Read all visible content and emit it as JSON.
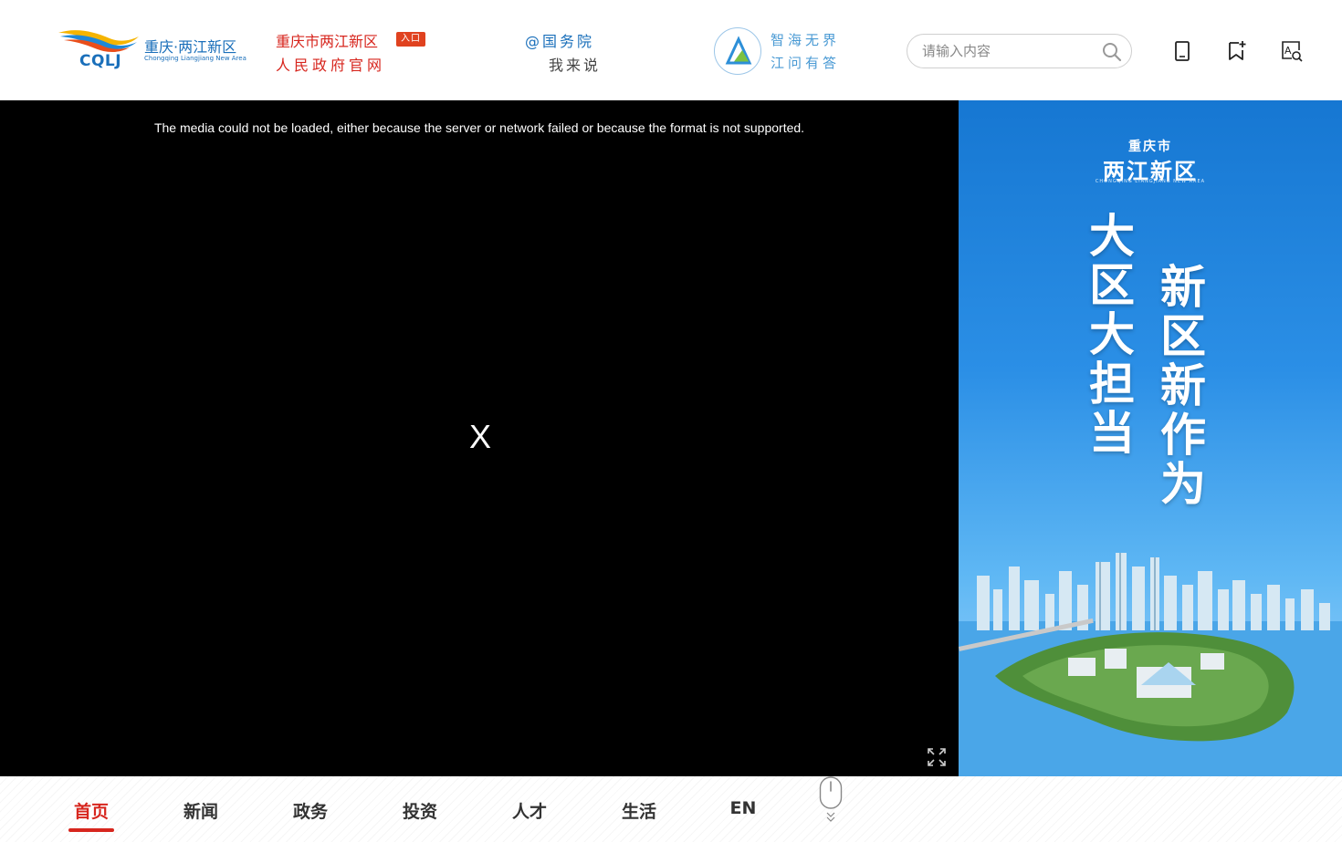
{
  "header": {
    "logo": {
      "abbr": "CQLJ",
      "name_cn": "重庆·两江新区",
      "name_en": "Chongqing Liangjiang New Area"
    },
    "gov_portal": {
      "line1": "重庆市两江新区",
      "badge": "入口",
      "line2": "人民政府官网"
    },
    "state_council": {
      "line1": "@国务院",
      "line2": "我来说"
    },
    "qa": {
      "line1": "智海无界",
      "line2": "江问有答"
    },
    "search": {
      "placeholder": "请输入内容",
      "icon": "search-icon"
    },
    "icons": [
      "mobile-icon",
      "bookmark-add-icon",
      "accessibility-icon"
    ]
  },
  "video": {
    "error_message": "The media could not be loaded, either because the server or network failed or because the format is not supported.",
    "close_label": "X",
    "fullscreen_icon": "expand-icon"
  },
  "poster": {
    "small_title": "重庆市",
    "big_title": "两江新区",
    "en_title": "CHONGQING LIANGJIANG NEW AREA",
    "slogan_left": "大区大担当",
    "slogan_right": "新区新作为"
  },
  "nav": {
    "items": [
      {
        "label": "首页",
        "active": true
      },
      {
        "label": "新闻",
        "active": false
      },
      {
        "label": "政务",
        "active": false
      },
      {
        "label": "投资",
        "active": false
      },
      {
        "label": "人才",
        "active": false
      },
      {
        "label": "生活",
        "active": false
      },
      {
        "label": "EN",
        "active": false
      }
    ],
    "scroll_icon": "mouse-scroll-icon"
  },
  "colors": {
    "brand_red": "#d7261e",
    "brand_blue": "#1a6fba",
    "qa_blue": "#4a9ad4"
  }
}
